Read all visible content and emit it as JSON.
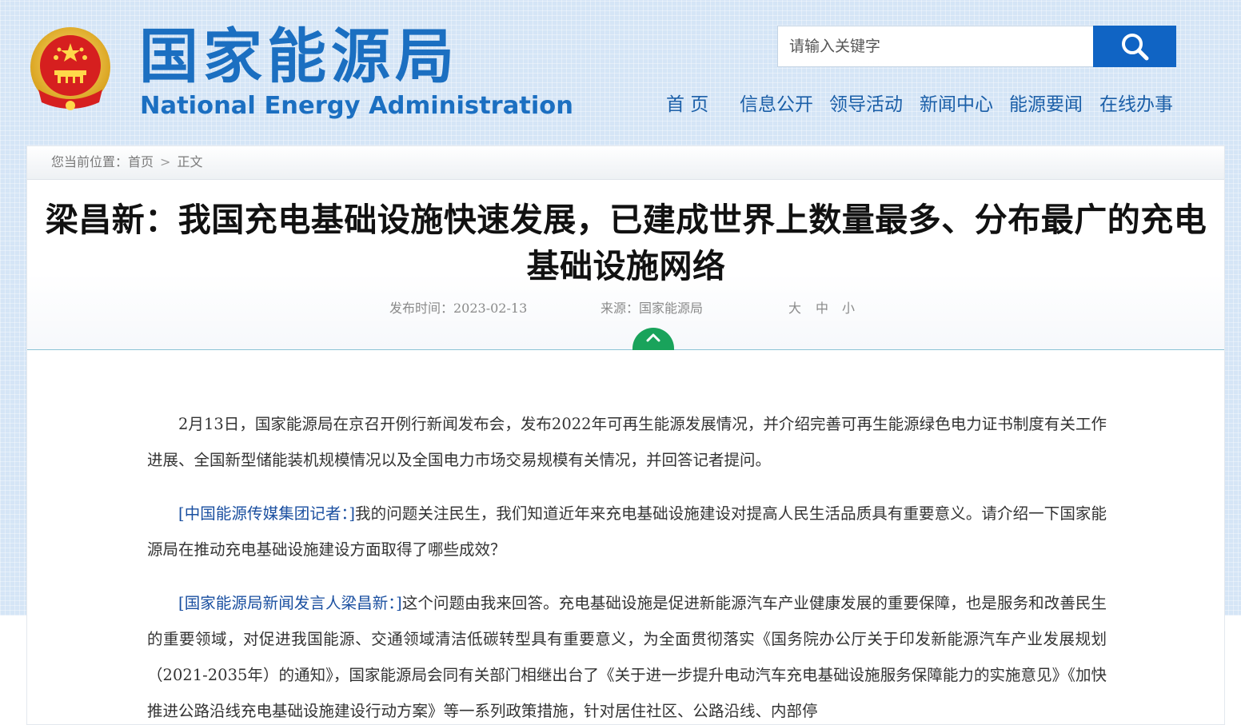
{
  "header": {
    "logo_cn": "国家能源局",
    "logo_en": "National Energy Administration",
    "search": {
      "placeholder": "请输入关键字"
    },
    "nav": [
      "首 页",
      "信息公开",
      "领导活动",
      "新闻中心",
      "能源要闻",
      "在线办事"
    ]
  },
  "breadcrumb": {
    "prefix": "您当前位置：",
    "home": "首页",
    "separator": ">",
    "current": "正文"
  },
  "article": {
    "title": "梁昌新：我国充电基础设施快速发展，已建成世界上数量最多、分布最广的充电基础设施网络",
    "publish_time": "发布时间：2023-02-13",
    "source": "来源：国家能源局",
    "font_sizes": [
      "大",
      "中",
      "小"
    ],
    "paragraphs": [
      {
        "speaker": "",
        "text": "2月13日，国家能源局在京召开例行新闻发布会，发布2022年可再生能源发展情况，并介绍完善可再生能源绿色电力证书制度有关工作进展、全国新型储能装机规模情况以及全国电力市场交易规模有关情况，并回答记者提问。"
      },
      {
        "speaker": "[中国能源传媒集团记者：]",
        "text": "我的问题关注民生，我们知道近年来充电基础设施建设对提高人民生活品质具有重要意义。请介绍一下国家能源局在推动充电基础设施建设方面取得了哪些成效？"
      },
      {
        "speaker": "[国家能源局新闻发言人梁昌新：]",
        "text": "这个问题由我来回答。充电基础设施是促进新能源汽车产业健康发展的重要保障，也是服务和改善民生的重要领域，对促进我国能源、交通领域清洁低碳转型具有重要意义，为全面贯彻落实《国务院办公厅关于印发新能源汽车产业发展规划（2021-2035年）的通知》，国家能源局会同有关部门相继出台了《关于进一步提升电动汽车充电基础设施服务保障能力的实施意见》《加快推进公路沿线充电基础设施建设行动方案》等一系列政策措施，针对居住社区、公路沿线、内部停"
      }
    ]
  },
  "colors": {
    "brand_blue": "#1b6fc1",
    "search_button": "#1064c4",
    "toggle_green": "#19a35b",
    "speaker_blue": "#1a4fa0"
  }
}
